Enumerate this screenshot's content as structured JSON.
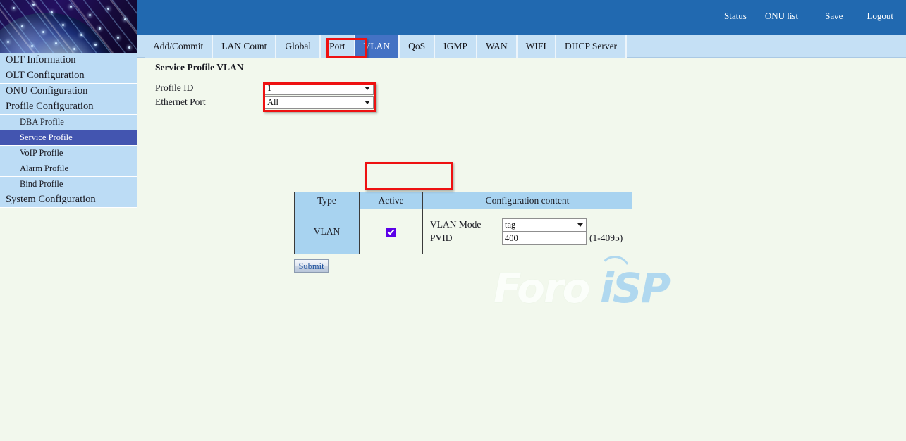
{
  "header": {
    "nav_links": [
      {
        "label": "Status"
      },
      {
        "label": "ONU list"
      },
      {
        "label": "Save"
      },
      {
        "label": "Logout"
      }
    ]
  },
  "tabs": [
    {
      "label": "Add/Commit",
      "selected": false
    },
    {
      "label": "LAN Count",
      "selected": false
    },
    {
      "label": "Global",
      "selected": false
    },
    {
      "label": "Port",
      "selected": false
    },
    {
      "label": "VLAN",
      "selected": true
    },
    {
      "label": "QoS",
      "selected": false
    },
    {
      "label": "IGMP",
      "selected": false
    },
    {
      "label": "WAN",
      "selected": false
    },
    {
      "label": "WIFI",
      "selected": false
    },
    {
      "label": "DHCP Server",
      "selected": false
    }
  ],
  "sidebar": {
    "items": [
      {
        "label": "OLT Information",
        "level": "top",
        "selected": false
      },
      {
        "label": "OLT Configuration",
        "level": "top",
        "selected": false
      },
      {
        "label": "ONU Configuration",
        "level": "top",
        "selected": false
      },
      {
        "label": "Profile Configuration",
        "level": "top",
        "selected": false
      },
      {
        "label": "DBA Profile",
        "level": "sub",
        "selected": false
      },
      {
        "label": "Service Profile",
        "level": "sub",
        "selected": true
      },
      {
        "label": "VoIP Profile",
        "level": "sub",
        "selected": false
      },
      {
        "label": "Alarm Profile",
        "level": "sub",
        "selected": false
      },
      {
        "label": "Bind Profile",
        "level": "sub",
        "selected": false
      },
      {
        "label": "System Configuration",
        "level": "top",
        "selected": false
      }
    ]
  },
  "main": {
    "page_title": "Service Profile VLAN",
    "form": {
      "profile_id": {
        "label": "Profile ID",
        "value": "1",
        "options": [
          "1"
        ]
      },
      "ethernet_port": {
        "label": "Ethernet Port",
        "value": "All",
        "options": [
          "All"
        ]
      }
    },
    "table": {
      "columns": [
        "Type",
        "Active",
        "Configuration content"
      ],
      "row": {
        "type": "VLAN",
        "active": true,
        "config": {
          "vlan_mode": {
            "label": "VLAN Mode",
            "value": "tag",
            "options": [
              "tag"
            ]
          },
          "pvid": {
            "label": "PVID",
            "value": "400",
            "hint": "(1-4095)"
          }
        }
      }
    },
    "submit_label": "Submit"
  },
  "watermark": {
    "text_light": "Foro",
    "text_blue": "iSP"
  },
  "colors": {
    "header_blue": "#2169b0",
    "tabbar_blue": "#c5e0f5",
    "tab_selected": "#4472c4",
    "sidebar_item": "#bcdcf5",
    "sidebar_selected": "#4355b0",
    "content_bg": "#f2f8ed",
    "table_header": "#a8d3f0",
    "highlight_red": "#ee1111",
    "checkbox_purple": "#5b00e8",
    "watermark_blue": "#b0d8ef"
  }
}
